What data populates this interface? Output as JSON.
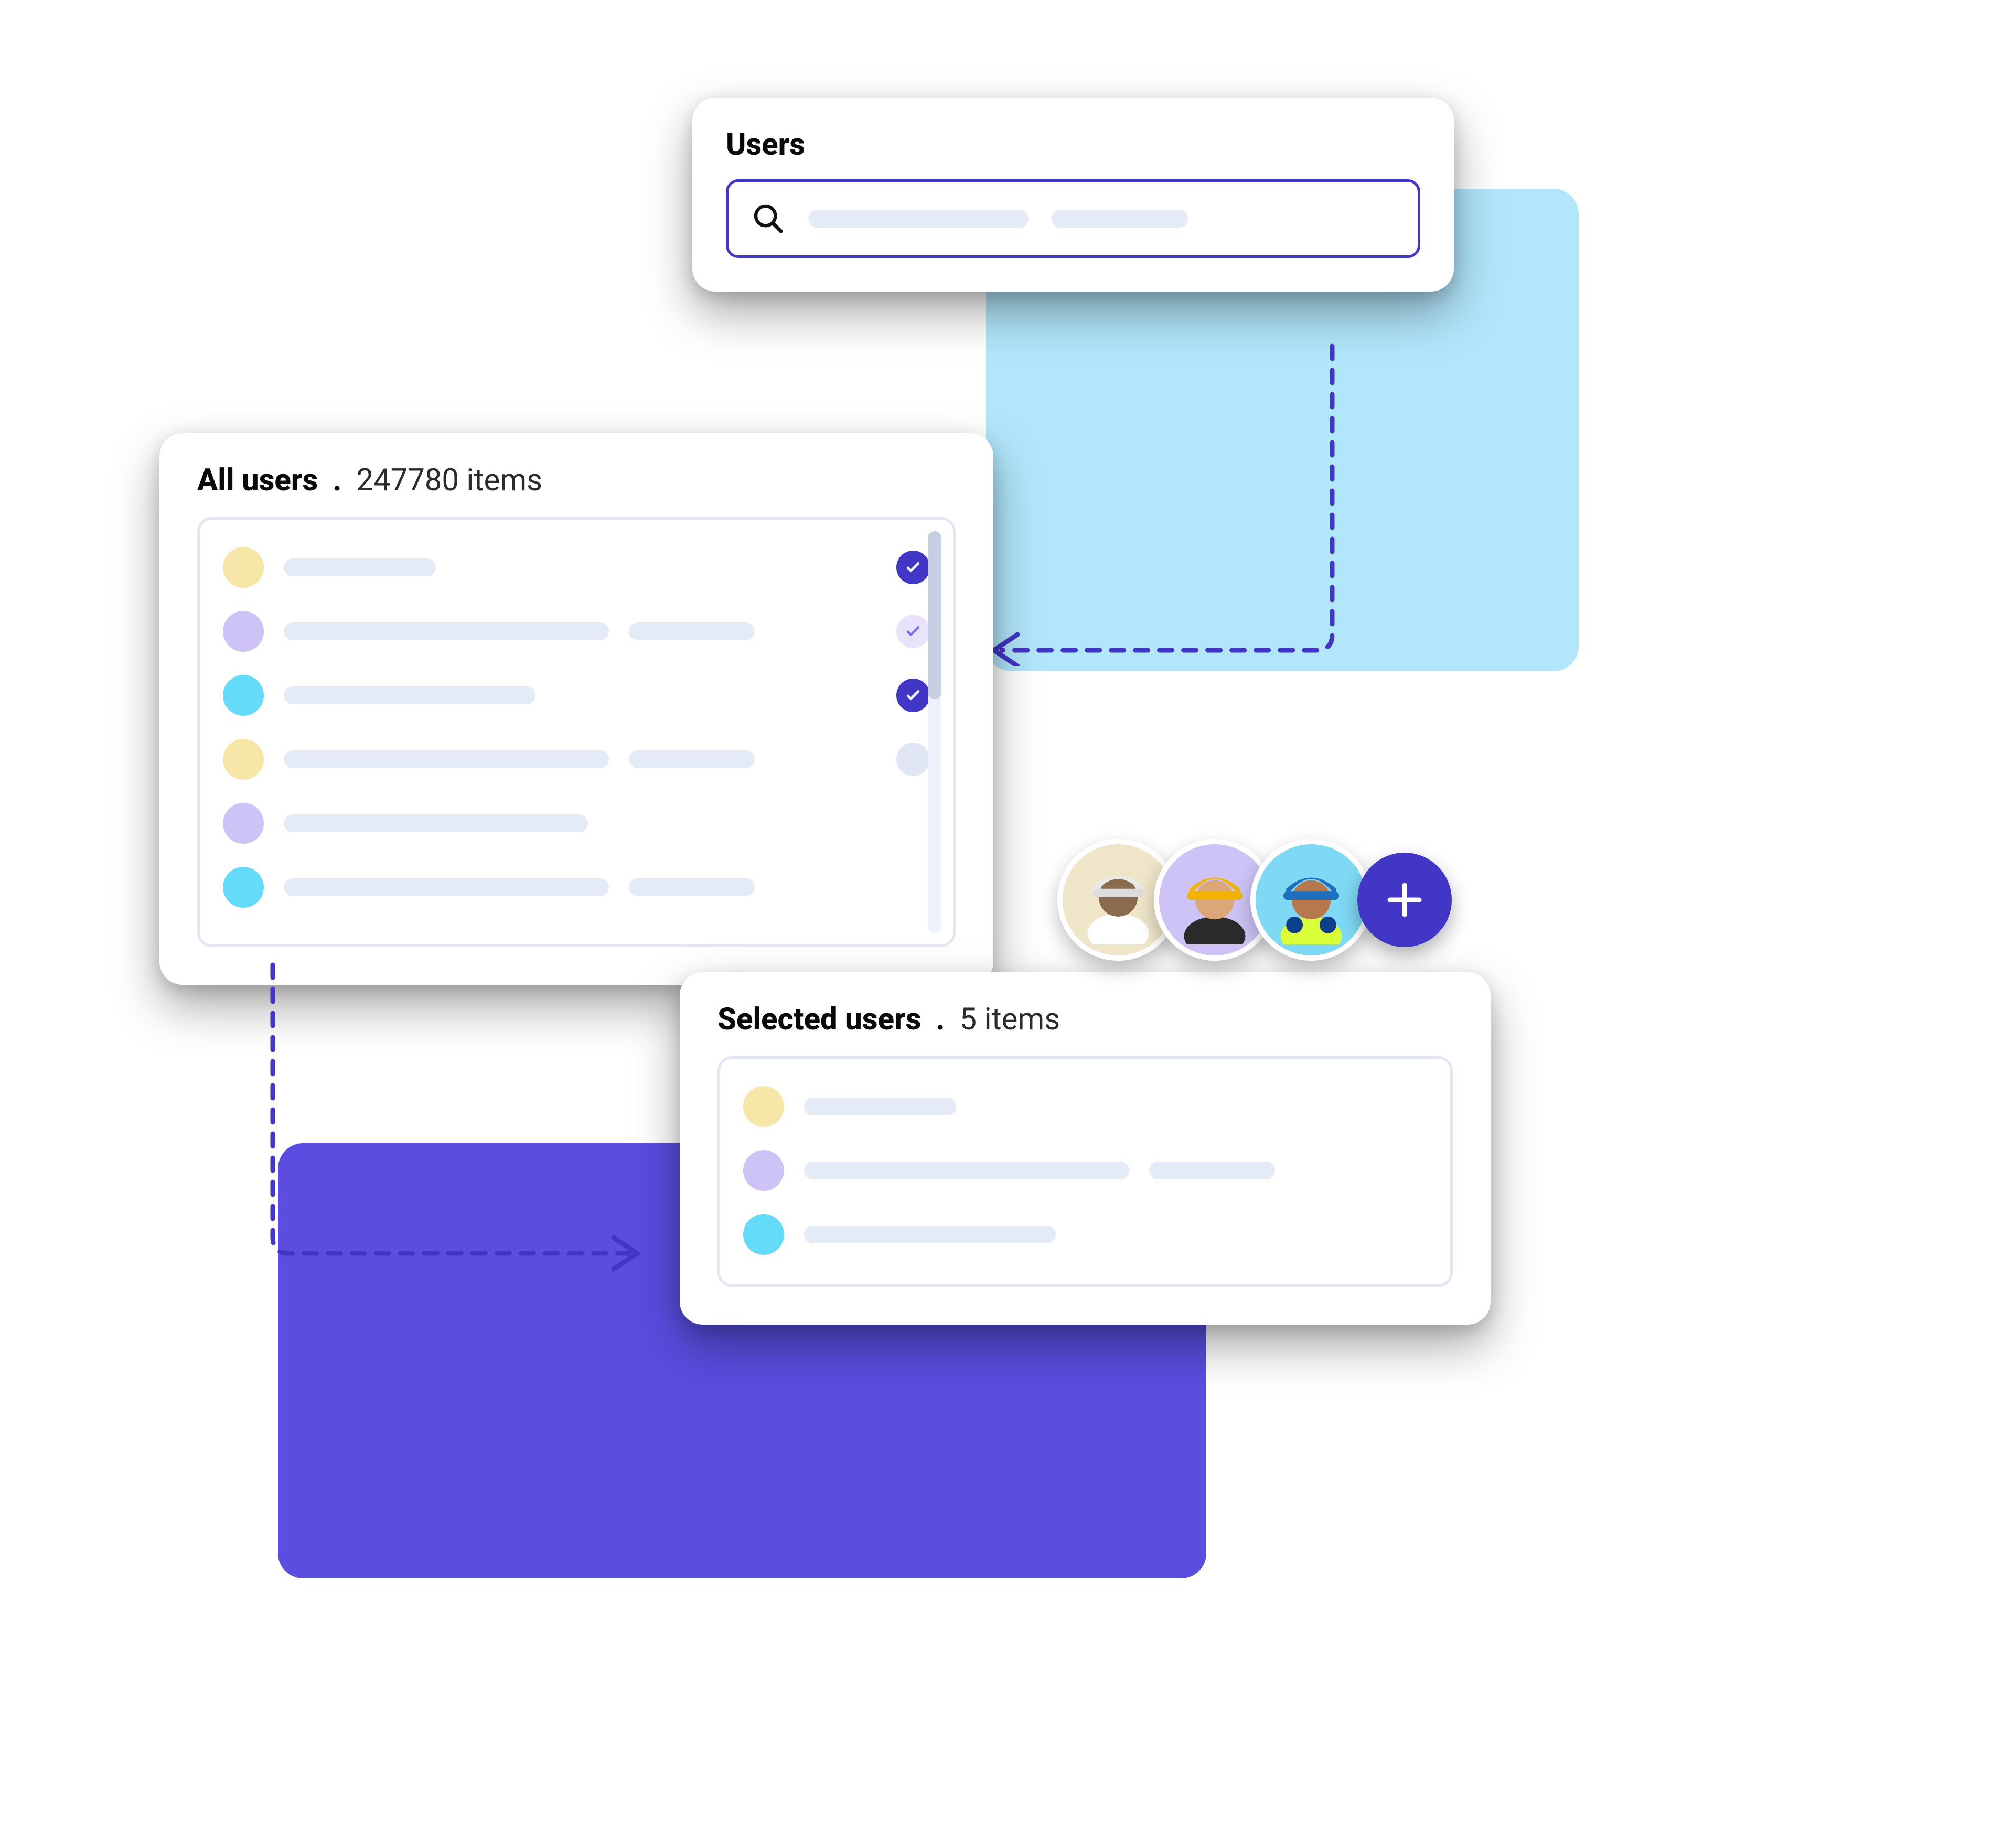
{
  "colors": {
    "accent": "#4236c7",
    "panel_cyan": "#b2e6fb",
    "panel_purple": "#5a4de0",
    "dot_yellow": "#f6e6a7",
    "dot_lavender": "#cdc3f6",
    "dot_cyan": "#64dcf9"
  },
  "search_card": {
    "title": "Users",
    "search_icon": "search-icon"
  },
  "all_users_card": {
    "title": "All users",
    "count_label": "247780 items",
    "rows": [
      {
        "avatar": "dot_yellow",
        "line_widths": [
          290
        ],
        "checked": "on"
      },
      {
        "avatar": "dot_lavender",
        "line_widths": [
          620,
          240
        ],
        "checked": "partial"
      },
      {
        "avatar": "dot_cyan",
        "line_widths": [
          480
        ],
        "checked": "on"
      },
      {
        "avatar": "dot_yellow",
        "line_widths": [
          620,
          240
        ],
        "checked": "off"
      },
      {
        "avatar": "dot_lavender",
        "line_widths": [
          580
        ],
        "checked": null
      },
      {
        "avatar": "dot_cyan",
        "line_widths": [
          620,
          240
        ],
        "checked": null
      }
    ]
  },
  "selected_users_card": {
    "title": "Selected users",
    "count_label": "5 items",
    "rows": [
      {
        "avatar": "dot_yellow",
        "line_widths": [
          290
        ]
      },
      {
        "avatar": "dot_lavender",
        "line_widths": [
          620,
          240
        ]
      },
      {
        "avatar": "dot_cyan",
        "line_widths": [
          480
        ]
      }
    ]
  },
  "avatar_strip": {
    "avatars": [
      {
        "bg": "#efe6c9"
      },
      {
        "bg": "#cdc3f6"
      },
      {
        "bg": "#7fd9f4"
      }
    ],
    "add_button_icon": "plus-icon"
  }
}
